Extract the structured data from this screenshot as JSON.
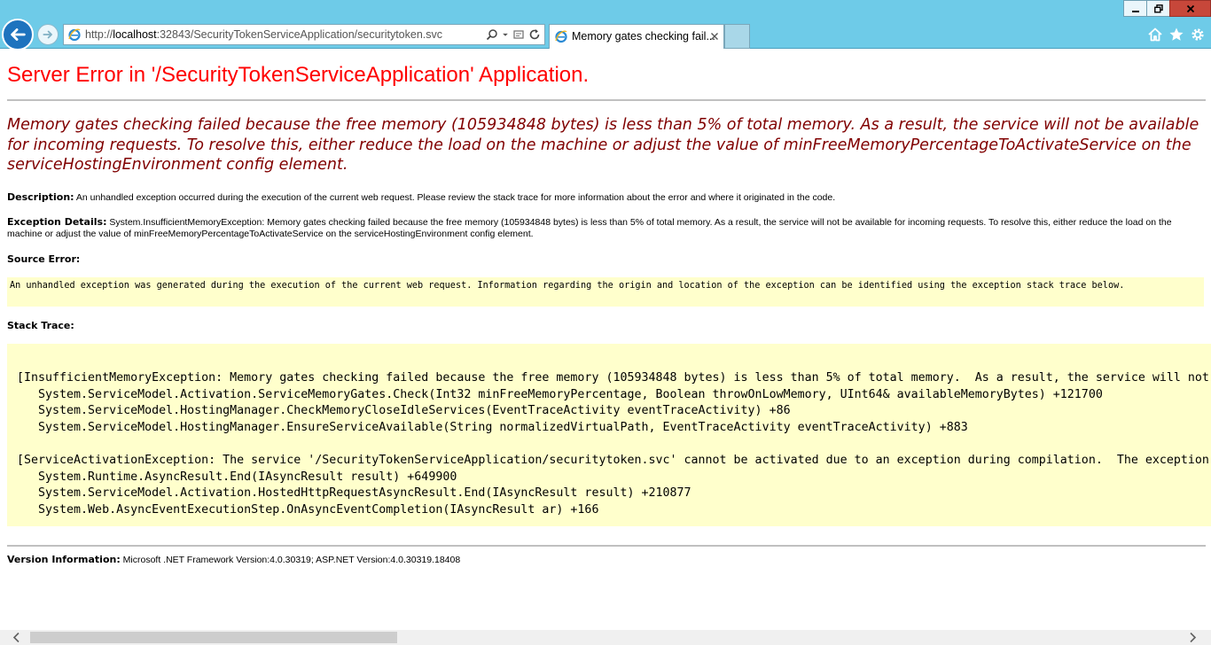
{
  "browser": {
    "url_prefix": "http://",
    "url_host": "localhost",
    "url_rest": ":32843/SecurityTokenServiceApplication/securitytoken.svc",
    "tab_title": "Memory gates checking fail...",
    "colors": {
      "chrome": "#6ecbe8",
      "back": "#1e73be",
      "close": "#c7473a"
    },
    "icons": [
      "back-arrow-icon",
      "forward-arrow-icon",
      "ie-logo-icon",
      "search-icon",
      "dropdown-icon",
      "compatibility-view-icon",
      "refresh-icon",
      "tab-close-icon",
      "minimize-icon",
      "restore-icon",
      "window-close-icon",
      "home-icon",
      "favorites-star-icon",
      "tools-gear-icon"
    ]
  },
  "page": {
    "heading": "Server Error in '/SecurityTokenServiceApplication' Application.",
    "error_message": "Memory gates checking failed because the free memory (105934848 bytes) is less than 5% of total memory.  As a result, the service will not be available for incoming requests.  To resolve this, either reduce the load on the machine or adjust the value of minFreeMemoryPercentageToActivateService on the serviceHostingEnvironment config element.",
    "description_label": "Description:",
    "description_text": " An unhandled exception occurred during the execution of the current web request. Please review the stack trace for more information about the error and where it originated in the code.",
    "exception_label": "Exception Details:",
    "exception_text": " System.InsufficientMemoryException: Memory gates checking failed because the free memory (105934848 bytes) is less than 5% of total memory.  As a result, the service will not be available for incoming requests.  To resolve this, either reduce the load on the machine or adjust the value of minFreeMemoryPercentageToActivateService on the serviceHostingEnvironment config element.",
    "source_error_label": "Source Error:",
    "source_error_text": "An unhandled exception was generated during the execution of the current web request. Information regarding the origin and location of the exception can be identified using the exception stack trace below.",
    "stack_trace_label": "Stack Trace:",
    "stack_trace_lines": [
      "[InsufficientMemoryException: Memory gates checking failed because the free memory (105934848 bytes) is less than 5% of total memory.  As a result, the service will not be available for incoming requests.  To resolve this, either reduce the load on the machine or adjust the value of minFreeMemoryPercentageToActivateService on the serviceHostingEnvironment config element.]",
      "   System.ServiceModel.Activation.ServiceMemoryGates.Check(Int32 minFreeMemoryPercentage, Boolean throwOnLowMemory, UInt64& availableMemoryBytes) +121700",
      "   System.ServiceModel.HostingManager.CheckMemoryCloseIdleServices(EventTraceActivity eventTraceActivity) +86",
      "   System.ServiceModel.HostingManager.EnsureServiceAvailable(String normalizedVirtualPath, EventTraceActivity eventTraceActivity) +883",
      "",
      "[ServiceActivationException: The service '/SecurityTokenServiceApplication/securitytoken.svc' cannot be activated due to an exception during compilation.  The exception message is: Memory gates checking failed because the free memory (105934848 bytes) is less than 5% of total memory.]",
      "   System.Runtime.AsyncResult.End(IAsyncResult result) +649900",
      "   System.ServiceModel.Activation.HostedHttpRequestAsyncResult.End(IAsyncResult result) +210877",
      "   System.Web.AsyncEventExecutionStep.OnAsyncEventCompletion(IAsyncResult ar) +166"
    ],
    "version_label": "Version Information:",
    "version_text": " Microsoft .NET Framework Version:4.0.30319; ASP.NET Version:4.0.30319.18408",
    "colors": {
      "heading": "#ff0000",
      "message": "#800000",
      "code_bg": "#ffffcc",
      "rule": "#c0c0c0"
    }
  },
  "scrollbar": {
    "horizontal_position": 0
  }
}
